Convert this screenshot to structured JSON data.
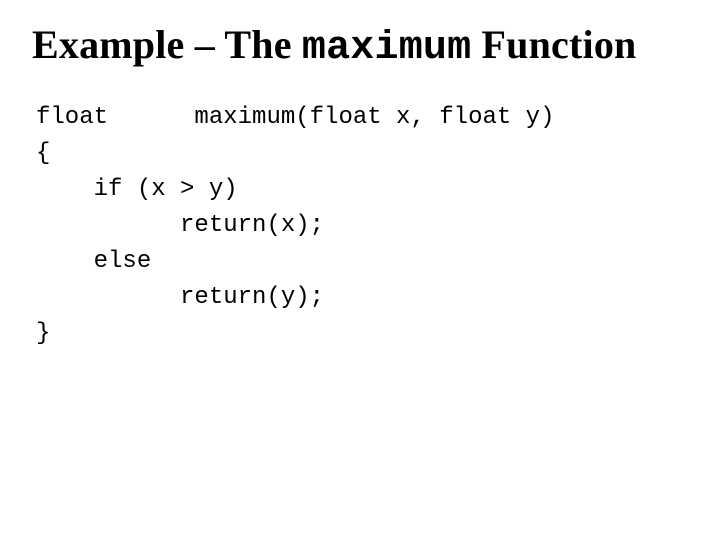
{
  "title": {
    "prefix": "Example – The ",
    "keyword": "maximum",
    "suffix": " Function"
  },
  "code": {
    "lines": [
      "float      maximum(float x, float y)",
      "{",
      "    if (x > y)",
      "          return(x);",
      "    else",
      "          return(y);",
      "}"
    ]
  }
}
